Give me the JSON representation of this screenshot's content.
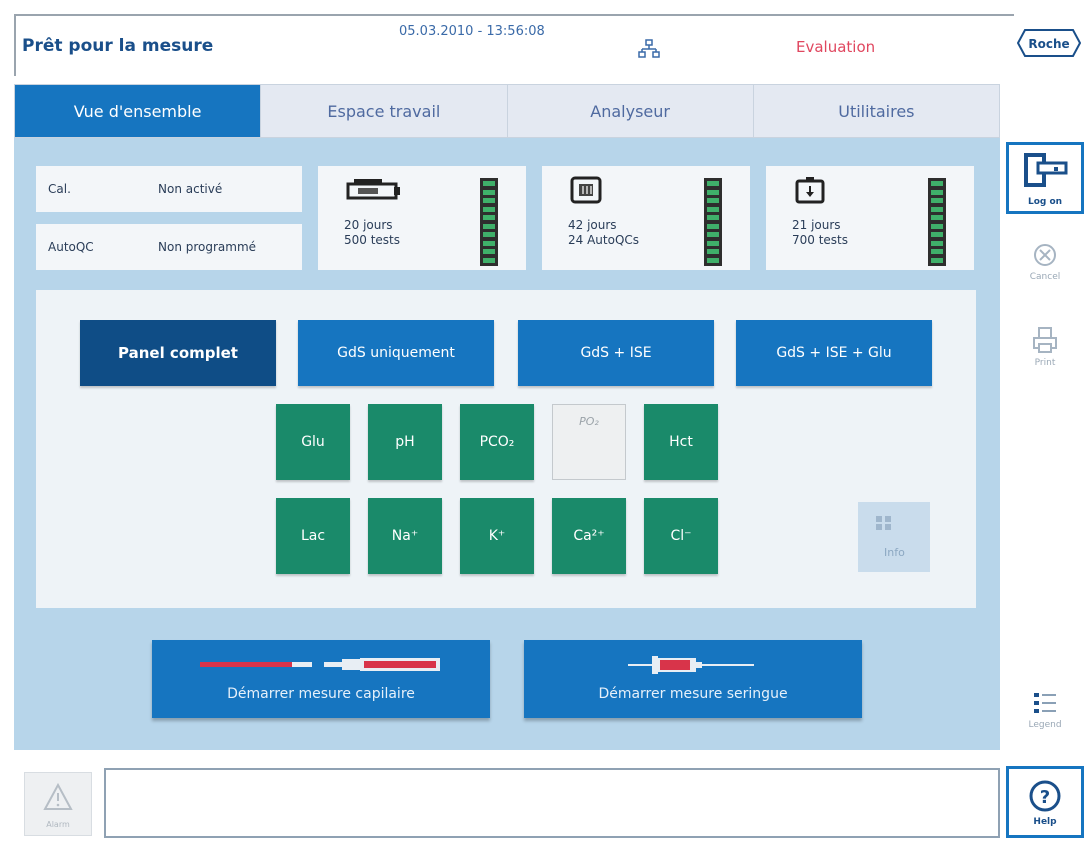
{
  "header": {
    "status": "Prêt pour la mesure",
    "datetime": "05.03.2010 - 13:56:08",
    "mode": "Evaluation",
    "logo_text": "Roche"
  },
  "tabs": [
    {
      "label": "Vue d'ensemble",
      "active": true
    },
    {
      "label": "Espace travail",
      "active": false
    },
    {
      "label": "Analyseur",
      "active": false
    },
    {
      "label": "Utilitaires",
      "active": false
    }
  ],
  "status": {
    "cal_label": "Cal.",
    "cal_value": "Non activé",
    "autoqc_label": "AutoQC",
    "autoqc_value": "Non programmé"
  },
  "consumables": [
    {
      "icon": "sensor-cartridge-icon",
      "line1": "20 jours",
      "line2": "500 tests",
      "level_segments": 10
    },
    {
      "icon": "qc-pack-icon",
      "line1": "42 jours",
      "line2": "24 AutoQCs",
      "level_segments": 10
    },
    {
      "icon": "fluid-pack-icon",
      "line1": "21 jours",
      "line2": "700 tests",
      "level_segments": 10
    }
  ],
  "panels": {
    "full": "Panel complet",
    "bg_only": "GdS uniquement",
    "bg_ise": "GdS + ISE",
    "bg_ise_glu": "GdS + ISE + Glu"
  },
  "params_row1": [
    "Glu",
    "pH",
    "PCO₂",
    "PO₂",
    "Hct"
  ],
  "params_row2": [
    "Lac",
    "Na⁺",
    "K⁺",
    "Ca²⁺",
    "Cl⁻"
  ],
  "info_label": "Info",
  "measure": {
    "capillary": "Démarrer mesure capilaire",
    "syringe": "Démarrer mesure seringue"
  },
  "sidebar": {
    "logon": "Log on",
    "cancel": "Cancel",
    "print": "Print",
    "legend": "Legend",
    "help": "Help"
  },
  "alarm_label": "Alarm",
  "colors": {
    "accent": "#1675c0",
    "selected": "#0f4d86",
    "param": "#1a8a6a",
    "mode": "#e0475f"
  }
}
